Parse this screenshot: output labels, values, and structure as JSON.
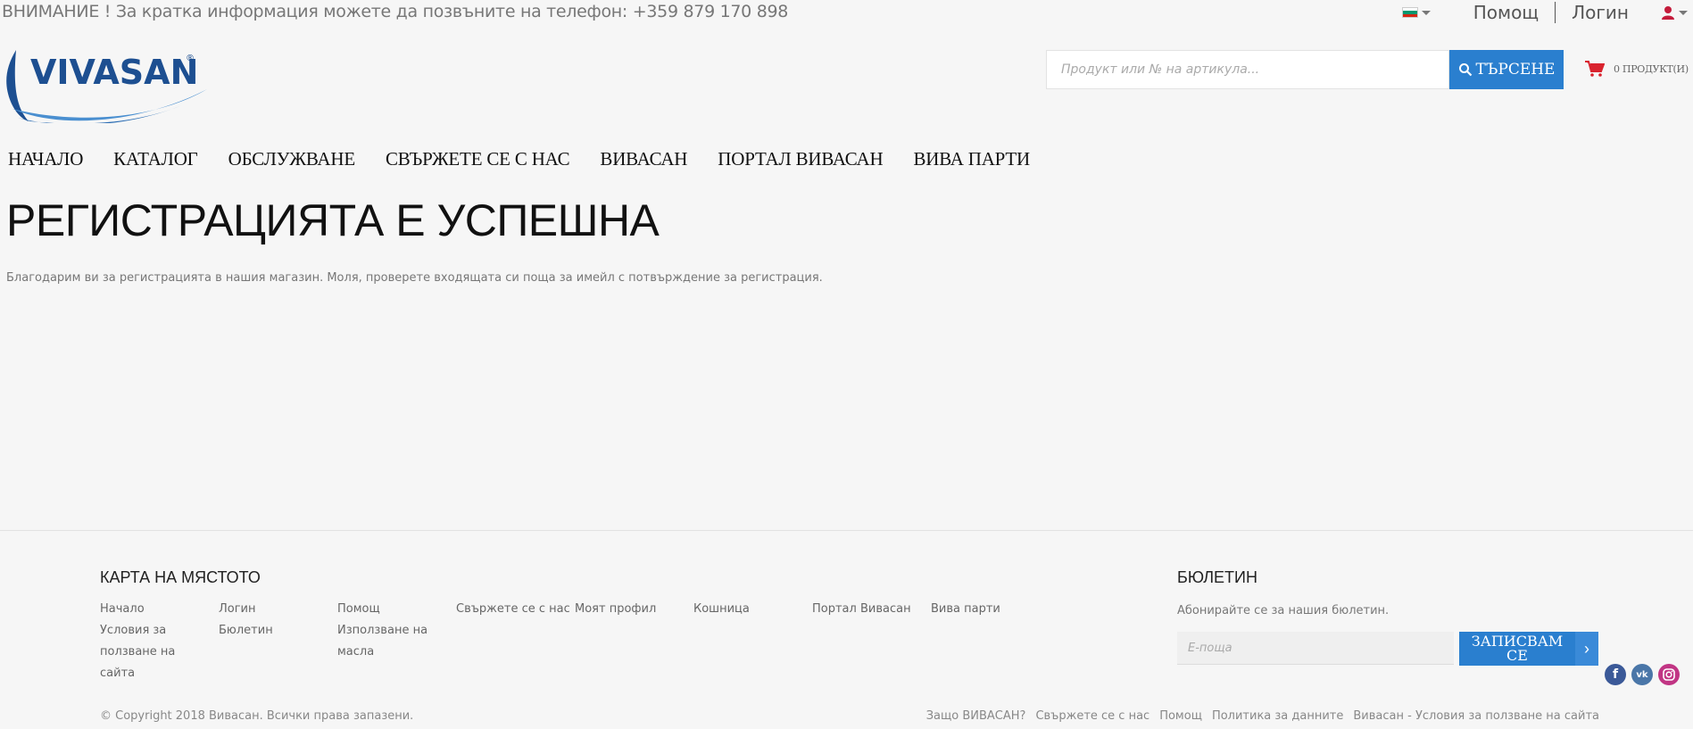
{
  "topbar": {
    "notice": "ВНИМАНИЕ ! За кратка информация можете да позвъните на телефон: +359 879 170 898",
    "language_flag": "bg-flag-icon",
    "help": "Помощ",
    "login": "Логин",
    "user_icon": "user-icon"
  },
  "header": {
    "logo_text": "VIVASAN",
    "search_placeholder": "Продукт или № на артикула...",
    "search_button": "ТЪРСЕНЕ",
    "cart_text": "0 ПРОДУКТ(И)"
  },
  "nav": [
    "НАЧАЛО",
    "КАТАЛОГ",
    "ОБСЛУЖВАНЕ",
    "СВЪРЖЕТЕ СЕ С НАС",
    "ВИВАСАН",
    "ПОРТАЛ ВИВАСАН",
    "ВИВА ПАРТИ"
  ],
  "main": {
    "title": "РЕГИСТРАЦИЯТА Е УСПЕШНА",
    "message": "Благодарим ви за регистрацията в нашия магазин. Моля, проверете входящата си поща за имейл с потвърждение за регистрация."
  },
  "footer": {
    "sitemap_title": "КАРТА НА МЯСТОТО",
    "sitemap_columns": [
      [
        "Начало",
        "Условия за ползване на сайта"
      ],
      [
        "Логин",
        "Бюлетин"
      ],
      [
        "Помощ",
        "Използване на масла"
      ],
      [
        "Свържете се с нас"
      ],
      [
        "Моят профил"
      ],
      [
        "Кошница"
      ],
      [
        "Портал Вивасан"
      ],
      [
        "Вива парти"
      ]
    ],
    "newsletter_title": "БЮЛЕТИН",
    "newsletter_desc": "Абонирайте се за нашия бюлетин.",
    "newsletter_placeholder": "Е-поща",
    "newsletter_button": "ЗАПИСВАМ СЕ",
    "copyright": "© Copyright 2018 Вивасан. Всички права запазени.",
    "bottom_links": [
      "Защо ВИВАСАН?",
      "Свържете се с нас",
      "Помощ",
      "Политика за данните",
      "Вивасан - Условия за ползване на сайта"
    ],
    "socials": [
      {
        "name": "facebook-icon",
        "glyph": "f",
        "color": "#3b5998"
      },
      {
        "name": "vk-icon",
        "glyph": "vk",
        "color": "#4a76a8"
      },
      {
        "name": "instagram-icon",
        "glyph": "◎",
        "color": "#c13584"
      }
    ]
  },
  "colors": {
    "accent": "#2a7fcf",
    "cart": "#d9232e",
    "logo_blue": "#1d4f91"
  }
}
